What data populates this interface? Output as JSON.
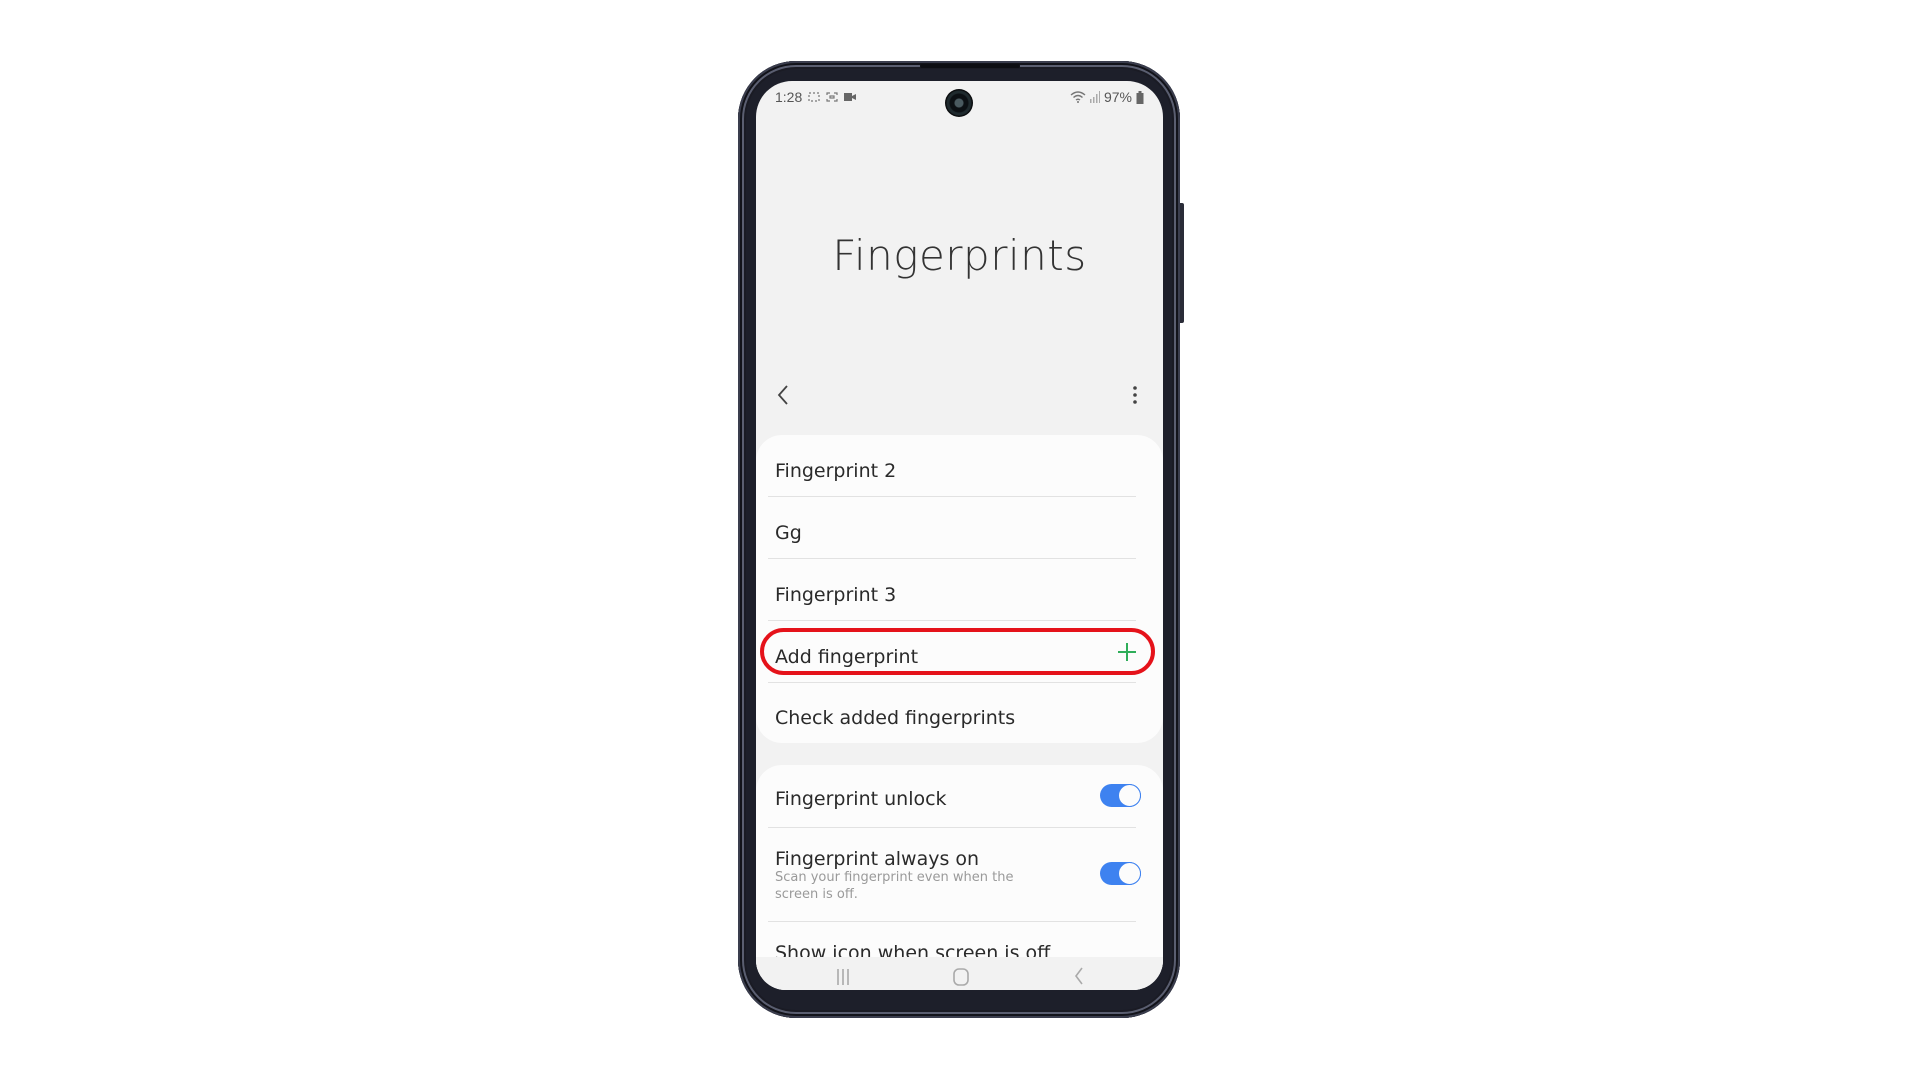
{
  "status_bar": {
    "time": "1:28",
    "left_icons": [
      "screenshot-icon",
      "screen-capture-icon",
      "video-record-icon"
    ],
    "battery": "97%",
    "right_icons": [
      "wifi-icon",
      "signal-icon",
      "battery-icon"
    ]
  },
  "header": {
    "title": "Fingerprints",
    "back_icon": "back-chevron-icon",
    "more_icon": "more-options-icon"
  },
  "fingerprints_card": {
    "items": [
      {
        "label": "Fingerprint 2"
      },
      {
        "label": "Gg"
      },
      {
        "label": "Fingerprint 3"
      },
      {
        "label": "Add fingerprint",
        "icon": "plus-icon",
        "icon_color": "#2fae5a"
      },
      {
        "label": "Check added fingerprints"
      }
    ]
  },
  "settings_card": {
    "items": [
      {
        "label": "Fingerprint unlock",
        "toggle": true
      },
      {
        "label": "Fingerprint always on",
        "subtitle": "Scan your fingerprint even when the screen is off.",
        "toggle": true
      },
      {
        "label": "Show icon when screen is off"
      }
    ]
  },
  "annotation": {
    "highlight_color": "#e5121a",
    "target": "Add fingerprint"
  },
  "colors": {
    "toggle_on": "#3e82f0",
    "background": "#f2f2f2",
    "card": "#fcfcfc"
  },
  "nav_bar": [
    "recents-icon",
    "home-icon",
    "back-icon"
  ]
}
